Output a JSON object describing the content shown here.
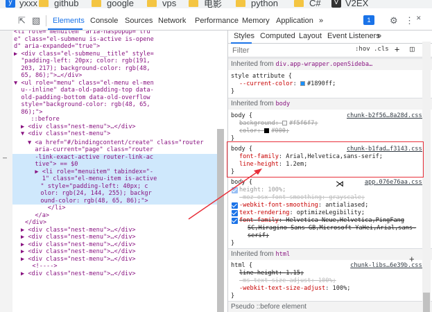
{
  "bookmarks": [
    "yxxx",
    "github",
    "google",
    "vps",
    "电影",
    "python",
    "C#",
    "V2EX"
  ],
  "toolbar": {
    "tabs": [
      "Elements",
      "Console",
      "Sources",
      "Network",
      "Performance",
      "Memory",
      "Application"
    ],
    "more": "»",
    "badge": "1",
    "active_tab": "Elements"
  },
  "styles_tabs": [
    "Styles",
    "Computed",
    "Layout",
    "Event Listeners",
    "»"
  ],
  "filter": {
    "placeholder": "Filter",
    "hov": ":hov",
    "cls": ".cls",
    "plus": "+"
  },
  "dom_lines": [
    {
      "t": "<li role=\"menuitem\" aria-haspopup=\"tru",
      "i": 120
    },
    {
      "t": "e\" class=\"el-submenu is-active is-opene",
      "i": 120
    },
    {
      "t": "d\" aria-expanded=\"true\">",
      "i": 120
    },
    {
      "t": "▶ <div class=\"el-submenu__title\" style=",
      "i": 120
    },
    {
      "t": "  \"padding-left: 20px; color: rgb(191,",
      "i": 120
    },
    {
      "t": "  203, 217); background-color: rgb(48,",
      "i": 120
    },
    {
      "t": "  65, 86);\">…</div>",
      "i": 120
    },
    {
      "t": "▼ <ul role=\"menu\" class=\"el-menu el-men",
      "i": 120
    },
    {
      "t": "  u--inline\" data-old-padding-top data-",
      "i": 120
    },
    {
      "t": "  old-padding-bottom data-old-overflow",
      "i": 120
    },
    {
      "t": "  style=\"background-color: rgb(48, 65,",
      "i": 120
    },
    {
      "t": "  86);\">",
      "i": 120
    },
    {
      "t": "  ::before",
      "i": 134
    },
    {
      "t": "▶ <div class=\"nest-menu\">…</div>",
      "i": 130
    },
    {
      "t": "▼ <div class=\"nest-menu\">",
      "i": 130
    }
  ],
  "dom_selected": [
    "▼ <a href=\"#/bindingcontent/create\" class=\"router",
    "  aria-current=\"page\" class=\"router",
    "  -link-exact-active router-link-ac",
    "  tive\"> == $0",
    "  ▶ <li role=\"menuitem\" tabindex=\"-",
    "    1\" class=\"el-menu-item is-active"
  ],
  "dom_after": [
    {
      "t": "  \" style=\"padding-left: 40px; c",
      "i": 148
    },
    {
      "t": "  olor: rgb(24, 144, 255); backgr",
      "i": 148
    },
    {
      "t": "  ound-color: rgb(48, 65, 86);\">",
      "i": 148
    },
    {
      "t": "    </li>",
      "i": 148
    },
    {
      "t": "  </a>",
      "i": 140
    },
    {
      "t": "</div>",
      "i": 136
    },
    {
      "t": "▶ <div class=\"nest-menu\">…</div>",
      "i": 130
    },
    {
      "t": "▶ <div class=\"nest-menu\">…</div>",
      "i": 130
    },
    {
      "t": "▶ <div class=\"nest-menu\">…</div>",
      "i": 130
    },
    {
      "t": "▶ <div class=\"nest-menu\">…</div>",
      "i": 130
    },
    {
      "t": "▶ <div class=\"nest-menu\">…</div>",
      "i": 130
    },
    {
      "t": "  <!---->",
      "i": 136
    },
    {
      "t": "▶ <div class=\"nest-menu\">…</div>",
      "i": 130
    }
  ],
  "styles": {
    "inherited_wrapper": "Inherited from",
    "wrapper_src": "div.app-wrapper.openSideba…",
    "style_attr": "style attribute {",
    "current_color_prop": "--current-color",
    "current_color_val": "#1890ff;",
    "inherited_body": "Inherited from",
    "body_src": "body",
    "rule1": {
      "selector": "body {",
      "link": "chunk-b2f56…8a28d.css:1",
      "bg_prop": "background",
      "bg_val": "#f5f6f7;",
      "color_prop": "color",
      "color_val": "#000;"
    },
    "rule2": {
      "selector": "body {",
      "link": "chunk-b1fad…f3143.css:1",
      "ff_prop": "font-family",
      "ff_val": "Arial,Helvetica,sans-serif;",
      "lh_prop": "line-height",
      "lh_val": "1.2em;"
    },
    "rule3": {
      "selector": "body {",
      "link": "app.076e76aa.css:1",
      "height_prop": "height",
      "height_val": "100%;",
      "moz_prop": "-moz-osx-font-smoothing",
      "moz_val": "grayscale;",
      "wk_prop": "-webkit-font-smoothing",
      "wk_val": "antialiased;",
      "tr_prop": "text-rendering",
      "tr_val": "optimizeLegibility;",
      "ff_prop": "font-family",
      "ff_val1": "Helvetica Neue,Helvetica,PingFang",
      "ff_val2": "SC,Hiragino Sans GB,Microsoft YaHei,Arial,sans-",
      "ff_val3": "serif;"
    },
    "inherited_html": "Inherited from",
    "html_src": "html",
    "rule4": {
      "selector": "html {",
      "link": "chunk-libs…6e39b.css:1",
      "lh_prop": "line-height",
      "lh_val": "1.15;",
      "ms_prop": "-ms-text-size-adjust",
      "ms_val": "100%;",
      "wk_prop": "-webkit-text-size-adjust",
      "wk_val": "100%;"
    },
    "pseudo": "Pseudo ::before element"
  },
  "colors": {
    "accent": "#1a73e8",
    "annotation": "#e8303a",
    "swatch_blue": "#1890ff",
    "swatch_light": "#f5f6f7",
    "swatch_black": "#000000"
  }
}
